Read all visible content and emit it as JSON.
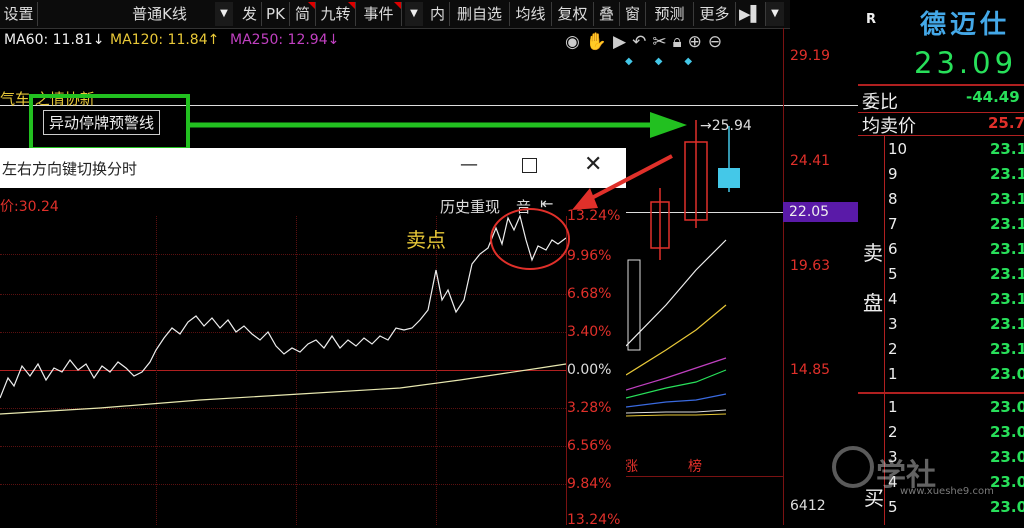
{
  "toolbar": {
    "items": [
      "设置",
      "普通K线",
      "发",
      "PK",
      "简",
      "九转",
      "事件",
      "内",
      "删自选",
      "均线",
      "复权",
      "叠",
      "窗",
      "预测",
      "更多",
      "▶▌"
    ]
  },
  "ma_line": {
    "ma60": "MA60: 11.81↓",
    "ma120": "MA120: 11.84↑",
    "ma250": "MA250: 12.94↓"
  },
  "axis_right": [
    "29.19",
    "24.41",
    "19.63",
    "14.85",
    "6412"
  ],
  "axis_highlight": "22.05",
  "peak_label": "25.94",
  "overlay_text": "气车  之情协新",
  "warning_line_label": "异动停牌预警线",
  "popup": {
    "title": "左右方向键切换分时",
    "price_label": "价:30.24",
    "history_button": "历史重现",
    "sound_button": "音",
    "pct_up": [
      "13.24%",
      "9.96%",
      "6.68%",
      "3.40%"
    ],
    "pct_zero": "0.00%",
    "pct_down": [
      "3.28%",
      "6.56%",
      "9.84%",
      "13.24%"
    ]
  },
  "sell_point": "卖点",
  "bottom_labels": [
    "涨",
    "榜"
  ],
  "quote": {
    "flag": "R",
    "name": "德迈仕",
    "price": "23.09",
    "weibi_label": "委比",
    "weibi_value": "-44.49",
    "avg_sell_label": "均卖价",
    "avg_sell_value": "25.7",
    "sell_side_label": "卖盘",
    "buy_side_label": "买",
    "sell_levels": [
      "10",
      "9",
      "8",
      "7",
      "6",
      "5",
      "4",
      "3",
      "2",
      "1"
    ],
    "sell_prices": [
      "23.1",
      "23.1",
      "23.1",
      "23.1",
      "23.1",
      "23.1",
      "23.1",
      "23.1",
      "23.1",
      "23.0"
    ],
    "buy_levels": [
      "1",
      "2",
      "3",
      "4",
      "5"
    ],
    "buy_prices": [
      "23.0",
      "23.0",
      "23.0",
      "23.0",
      "23.0"
    ]
  },
  "watermark": "学社",
  "watermark_url": "www.xueshe9.com",
  "colors": {
    "red": "#e0302a",
    "green": "#28e05a",
    "yellow": "#e8c838",
    "cyan": "#44c8e8",
    "purple": "#5a1aa8"
  }
}
